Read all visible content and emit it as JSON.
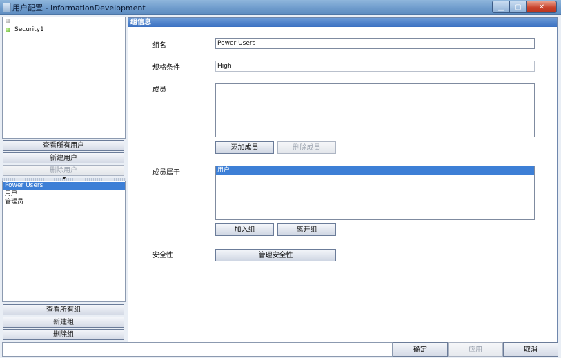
{
  "window": {
    "title": "用户配置 - InformationDevelopment"
  },
  "tree": {
    "items": [
      {
        "label": ""
      },
      {
        "label": "Security1"
      }
    ]
  },
  "user_buttons": {
    "view_all": "查看所有用户",
    "new": "新建用户",
    "delete": "删除用户"
  },
  "groups": {
    "items": [
      "Power Users",
      "用户",
      "管理员"
    ],
    "selected": "Power Users"
  },
  "group_buttons": {
    "view_all": "查看所有组",
    "new": "新建组",
    "delete": "删除组"
  },
  "group_info": {
    "header": "组信息",
    "name_label": "组名",
    "name_value": "Power Users",
    "spec_label": "规格条件",
    "spec_value": "High",
    "members_label": "成员",
    "add_member": "添加成员",
    "remove_member": "删除成员",
    "member_of_label": "成员属于",
    "member_of_items": [
      "用户"
    ],
    "join_group": "加入组",
    "leave_group": "离开组",
    "security_label": "安全性",
    "manage_security": "管理安全性"
  },
  "footer": {
    "ok": "确定",
    "apply": "应用",
    "cancel": "取消"
  }
}
